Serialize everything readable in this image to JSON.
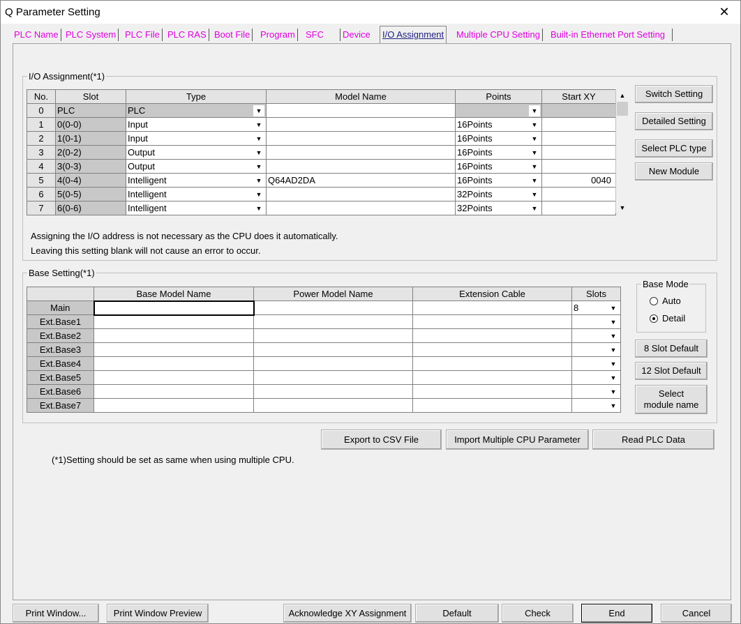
{
  "window": {
    "title": "Q Parameter Setting",
    "close_glyph": "✕"
  },
  "tabs": [
    {
      "label": "PLC Name"
    },
    {
      "label": "PLC System"
    },
    {
      "label": "PLC File"
    },
    {
      "label": "PLC RAS"
    },
    {
      "label": "Boot File"
    },
    {
      "label": "Program"
    },
    {
      "label": "SFC"
    },
    {
      "label": "Device"
    },
    {
      "label": "I/O Assignment",
      "active": true
    },
    {
      "label": "Multiple CPU Setting"
    },
    {
      "label": "Built-in Ethernet Port Setting"
    }
  ],
  "io": {
    "legend": "I/O Assignment(*1)",
    "headers": [
      "No.",
      "Slot",
      "Type",
      "Model Name",
      "Points",
      "Start XY"
    ],
    "rows": [
      {
        "no": "0",
        "slot": "PLC",
        "type": "PLC",
        "model": "",
        "points": "",
        "start": ""
      },
      {
        "no": "1",
        "slot": "0(0-0)",
        "type": "Input",
        "model": "",
        "points": "16Points",
        "start": ""
      },
      {
        "no": "2",
        "slot": "1(0-1)",
        "type": "Input",
        "model": "",
        "points": "16Points",
        "start": ""
      },
      {
        "no": "3",
        "slot": "2(0-2)",
        "type": "Output",
        "model": "",
        "points": "16Points",
        "start": ""
      },
      {
        "no": "4",
        "slot": "3(0-3)",
        "type": "Output",
        "model": "",
        "points": "16Points",
        "start": ""
      },
      {
        "no": "5",
        "slot": "4(0-4)",
        "type": "Intelligent",
        "model": "Q64AD2DA",
        "points": "16Points",
        "start": "0040"
      },
      {
        "no": "6",
        "slot": "5(0-5)",
        "type": "Intelligent",
        "model": "",
        "points": "32Points",
        "start": ""
      },
      {
        "no": "7",
        "slot": "6(0-6)",
        "type": "Intelligent",
        "model": "",
        "points": "32Points",
        "start": ""
      }
    ],
    "note1": "Assigning the I/O address is not necessary as the CPU does it automatically.",
    "note2": "Leaving this setting blank will not cause an error to occur.",
    "buttons": {
      "switch": "Switch Setting",
      "detailed": "Detailed Setting",
      "select_plc": "Select PLC type",
      "new_module": "New Module"
    }
  },
  "base": {
    "legend": "Base Setting(*1)",
    "headers": [
      "Base Model Name",
      "Power Model Name",
      "Extension Cable",
      "Slots"
    ],
    "rows": [
      {
        "label": "Main",
        "slots": "8"
      },
      {
        "label": "Ext.Base1",
        "slots": ""
      },
      {
        "label": "Ext.Base2",
        "slots": ""
      },
      {
        "label": "Ext.Base3",
        "slots": ""
      },
      {
        "label": "Ext.Base4",
        "slots": ""
      },
      {
        "label": "Ext.Base5",
        "slots": ""
      },
      {
        "label": "Ext.Base6",
        "slots": ""
      },
      {
        "label": "Ext.Base7",
        "slots": ""
      }
    ],
    "mode": {
      "legend": "Base Mode",
      "auto": "Auto",
      "detail": "Detail",
      "selected": "Detail"
    },
    "buttons": {
      "slot8": "8 Slot Default",
      "slot12": "12 Slot Default",
      "select_module_line1": "Select",
      "select_module_line2": "module name"
    }
  },
  "actions": {
    "export_csv": "Export to CSV File",
    "import_multi": "Import Multiple CPU Parameter",
    "read_plc": "Read PLC Data"
  },
  "footnote": "(*1)Setting should be set as same when using multiple CPU.",
  "bottom": {
    "print_window": "Print Window...",
    "print_preview": "Print Window Preview",
    "acknowledge": "Acknowledge XY Assignment",
    "default": "Default",
    "check": "Check",
    "end": "End",
    "cancel": "Cancel"
  }
}
